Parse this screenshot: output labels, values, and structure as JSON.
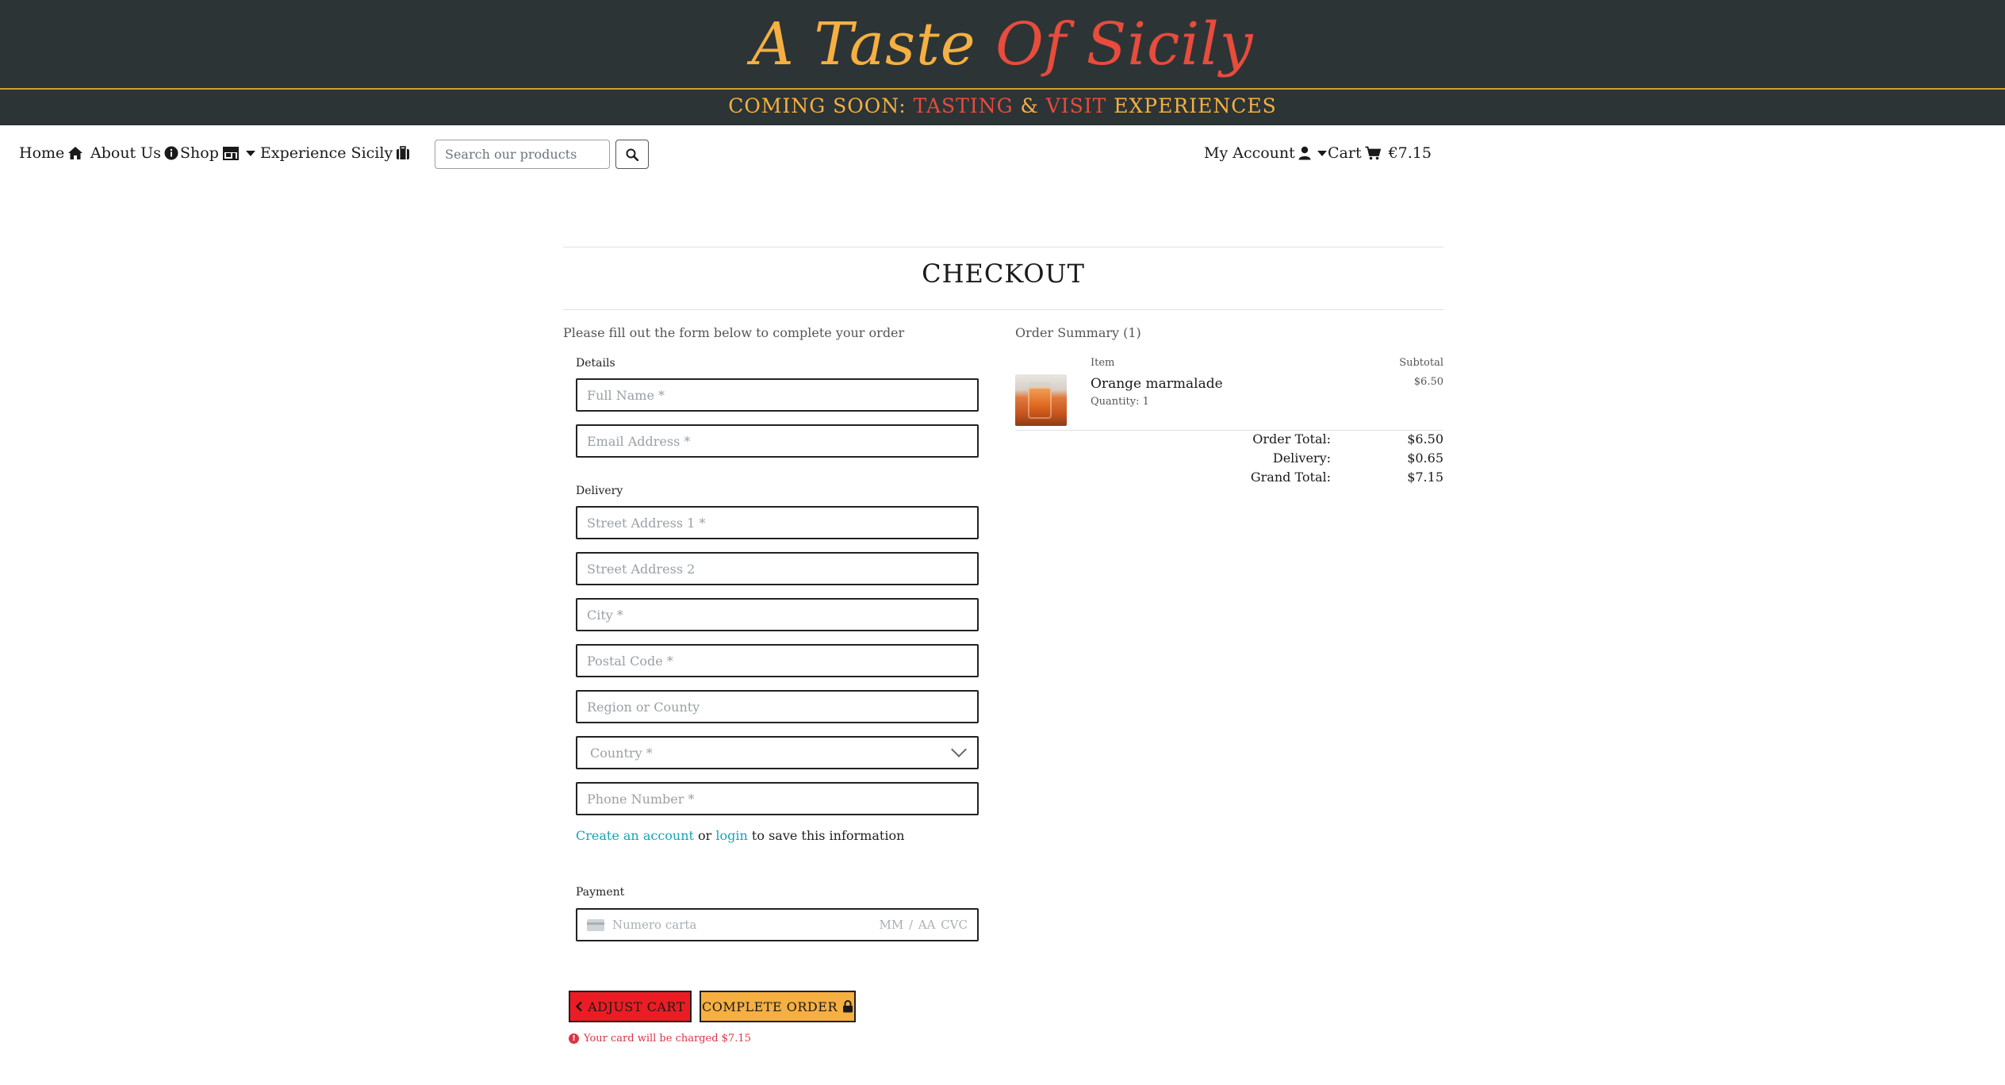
{
  "header": {
    "brand_part1": "A Taste ",
    "brand_part2": "Of Sicily",
    "banner": {
      "prefix": "COMING SOON: ",
      "tasting": "TASTING",
      "amp": " & ",
      "visit": "VISIT",
      "suffix": " EXPERIENCES"
    }
  },
  "nav": {
    "home": "Home",
    "about": "About Us",
    "shop": "Shop",
    "experience": "Experience Sicily",
    "search_placeholder": "Search our products",
    "account": "My Account",
    "cart": "Cart",
    "cart_total": "€7.15"
  },
  "checkout": {
    "title": "CHECKOUT",
    "instructions": "Please fill out the form below to complete your order",
    "details_label": "Details",
    "full_name_placeholder": "Full Name *",
    "email_placeholder": "Email Address *",
    "delivery_label": "Delivery",
    "street1_placeholder": "Street Address 1 *",
    "street2_placeholder": "Street Address 2",
    "city_placeholder": "City *",
    "postal_placeholder": "Postal Code *",
    "region_placeholder": "Region or County",
    "country_placeholder": "Country *",
    "phone_placeholder": "Phone Number *",
    "account_prompt": {
      "create_link": "Create an account",
      "or": " or ",
      "login_link": "login",
      "suffix": " to save this information"
    },
    "payment_label": "Payment",
    "card": {
      "number_placeholder": "Numero carta",
      "expiry_cvc_placeholder": "MM / AA  CVC"
    },
    "adjust_button": "ADJUST CART",
    "complete_button": "COMPLETE ORDER",
    "charge_note": "Your card will be charged $7.15"
  },
  "summary": {
    "heading": "Order Summary (1)",
    "col_item": "Item",
    "col_subtotal": "Subtotal",
    "items": [
      {
        "name": "Orange marmalade",
        "quantity": "Quantity: 1",
        "subtotal": "$6.50"
      }
    ],
    "order_total_label": "Order Total:",
    "order_total": "$6.50",
    "delivery_label": "Delivery:",
    "delivery": "$0.65",
    "grand_total_label": "Grand Total:",
    "grand_total": "$7.15"
  },
  "colors": {
    "header_bg": "#2d3436",
    "gold": "#f5b041",
    "red": "#e74c3c",
    "link": "#17a2b8",
    "adjust_btn": "#ec1c24",
    "error": "#dc3545"
  }
}
